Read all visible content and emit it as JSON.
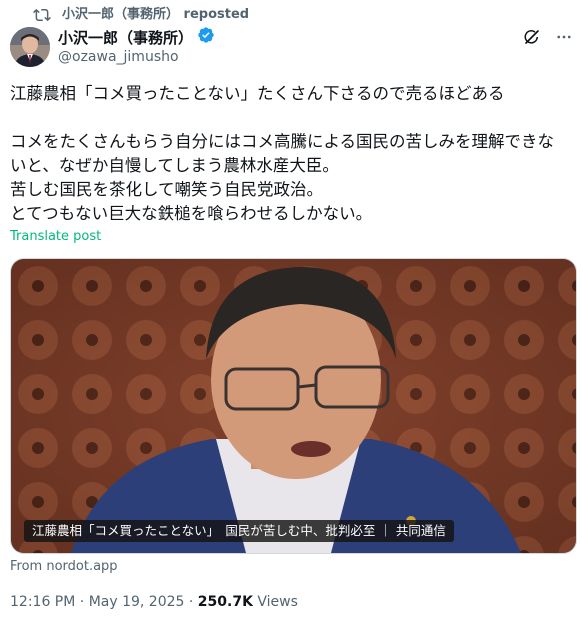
{
  "repost": {
    "author": "小沢一郎（事務所）",
    "label": "reposted",
    "icon": "repost-icon"
  },
  "author": {
    "name": "小沢一郎（事務所）",
    "handle": "@ozawa_jimusho",
    "verified_color": "#1d9bf0"
  },
  "post": {
    "lines": [
      "江藤農相「コメ買ったことない」たくさん下さるので売るほどある",
      "",
      "コメをたくさんもらう自分にはコメ高騰による国民の苦しみを理解できな",
      "いと、なぜか自慢してしまう農林水産大臣。",
      "苦しむ国民を茶化して嘲笑う自民党政治。",
      "とてつもない巨大な鉄槌を喰らわせるしかない。"
    ],
    "translate": "Translate post",
    "translate_color": "#00ba7c"
  },
  "media": {
    "caption": "江藤農相「コメ買ったことない」　国民が苦しむ中、批判必至 ｜ 共同通信",
    "source": "From nordot.app"
  },
  "meta": {
    "time": "12:16 PM",
    "date": "May 19, 2025",
    "views": "250.7K",
    "views_label": "Views"
  }
}
